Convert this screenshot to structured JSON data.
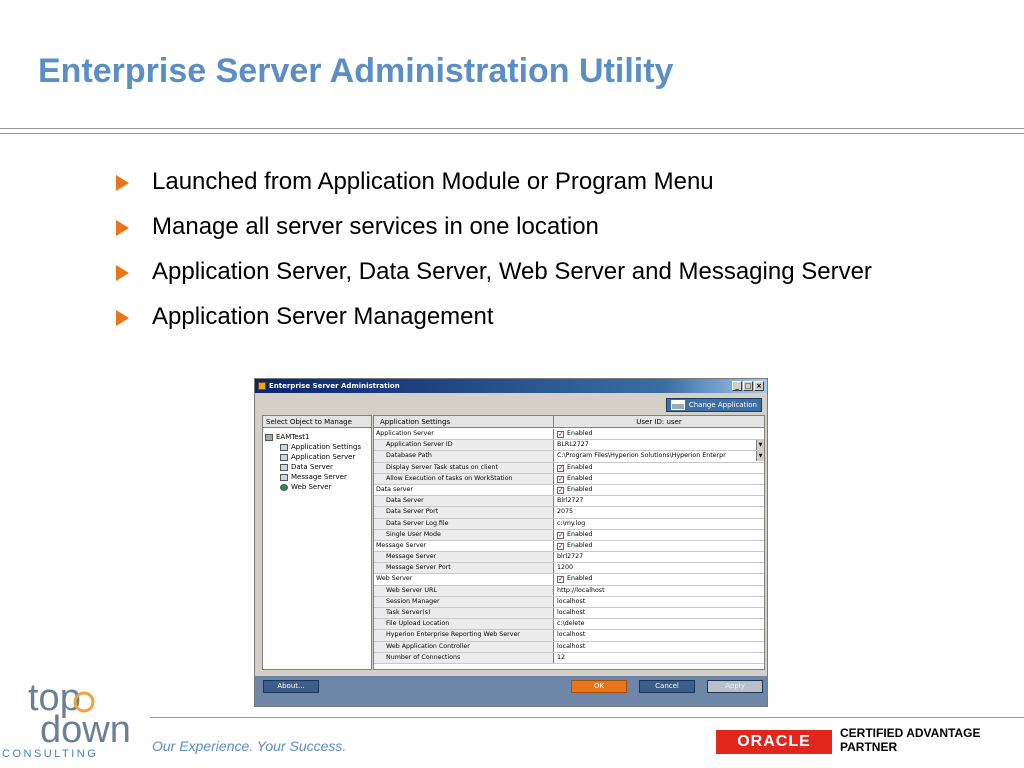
{
  "slide": {
    "title": "Enterprise Server Administration Utility",
    "bullets": [
      "Launched from Application Module or Program Menu",
      "Manage all server services in one location",
      "Application Server, Data Server, Web Server and Messaging Server",
      "Application Server Management"
    ]
  },
  "window": {
    "title": "Enterprise Server Administration",
    "minimize": "_",
    "maximize": "□",
    "close": "×",
    "change_application": "Change Application",
    "left_header": "Select Object to Manage",
    "tree": {
      "root": "EAMTest1",
      "children": [
        "Application Settings",
        "Application Server",
        "Data Server",
        "Message Server",
        "Web Server"
      ]
    },
    "right_header_left": "Application Settings",
    "right_header_right": "User ID: user",
    "rows": [
      {
        "label": "Application Server",
        "value": "Enabled",
        "section": true,
        "check": true
      },
      {
        "label": "Application Server ID",
        "value": "BLRL2727",
        "dropdown": true
      },
      {
        "label": "Database Path",
        "value": "C:\\Program Files\\Hyperion Solutions\\Hyperion Enterpr",
        "dropdown": true
      },
      {
        "label": "Display Server Task status on client",
        "value": "Enabled",
        "check": true
      },
      {
        "label": "Allow Execution of tasks on WorkStation",
        "value": "Enabled",
        "check": true
      },
      {
        "label": "Data server",
        "value": "Enabled",
        "section": true,
        "check": true
      },
      {
        "label": "Data Server",
        "value": "Blrl2727"
      },
      {
        "label": "Data Server Port",
        "value": "2075"
      },
      {
        "label": "Data Server Log file",
        "value": "c:\\my.log"
      },
      {
        "label": "Single User Mode",
        "value": "Enabled",
        "check": true
      },
      {
        "label": "Message Server",
        "value": "Enabled",
        "section": true,
        "check": true
      },
      {
        "label": "Message Server",
        "value": "blrl2727"
      },
      {
        "label": "Message Server Port",
        "value": "1200"
      },
      {
        "label": "Web Server",
        "value": "Enabled",
        "section": true,
        "check": true
      },
      {
        "label": "Web Server URL",
        "value": "http://localhost"
      },
      {
        "label": "Session Manager",
        "value": "localhost"
      },
      {
        "label": "Task Server(s)",
        "value": "localhost"
      },
      {
        "label": "File Upload Location",
        "value": "c:\\delete"
      },
      {
        "label": "Hyperion Enterprise Reporting Web Server",
        "value": "localhost"
      },
      {
        "label": "Web Application Controller",
        "value": "localhost"
      },
      {
        "label": "Number of Connections",
        "value": "12"
      }
    ],
    "buttons": {
      "about": "About...",
      "ok": "OK",
      "cancel": "Cancel",
      "apply": "Apply"
    }
  },
  "footer": {
    "logo_top": "top",
    "logo_down": "down",
    "logo_sub": "CONSULTING",
    "tagline": "Our Experience. Your Success.",
    "oracle": "ORACLE",
    "partner_line1": "CERTIFIED ADVANTAGE",
    "partner_line2": "PARTNER"
  },
  "colors": {
    "title": "#5b8ec3",
    "bullet_arrow": "#e8751a",
    "oracle_red": "#e1261c",
    "logo_orange": "#f2a23a",
    "logo_blue": "#4a7fb5"
  }
}
